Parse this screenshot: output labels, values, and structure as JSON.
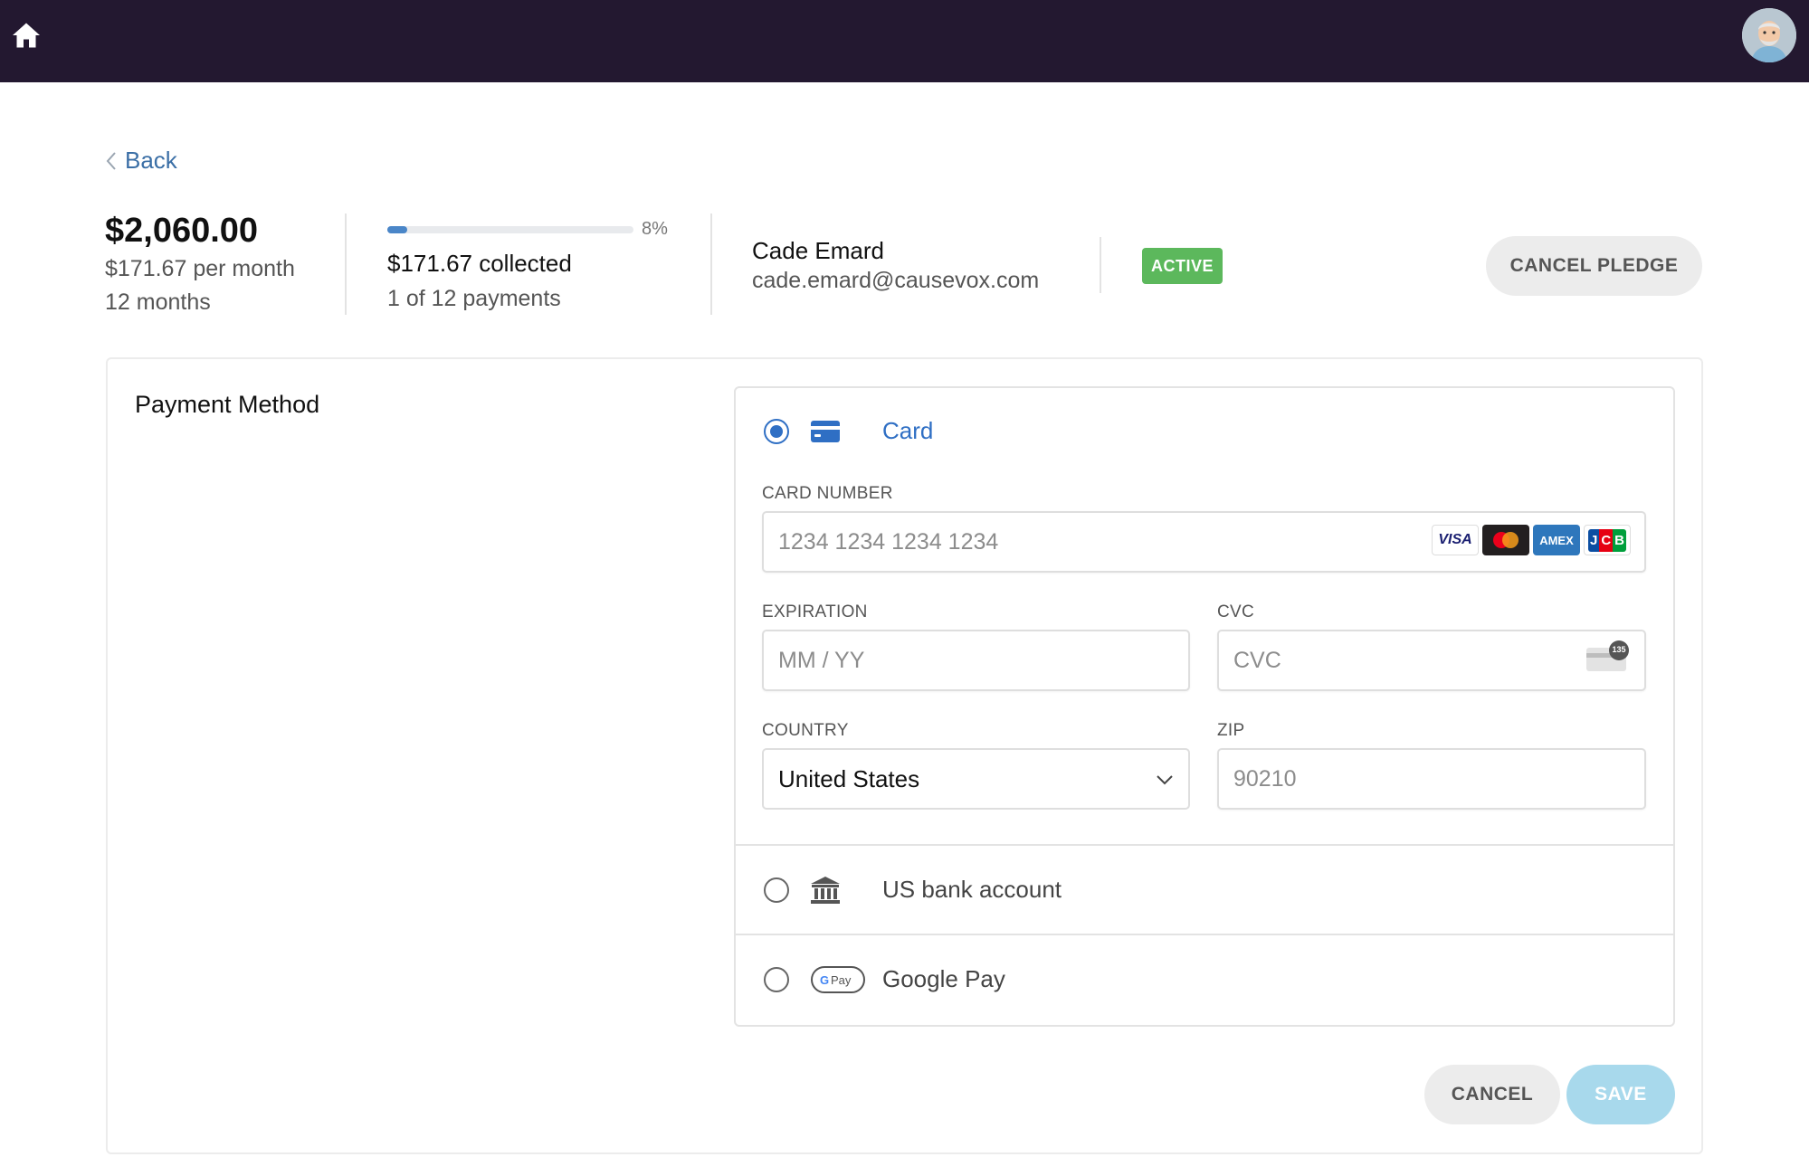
{
  "topbar": {
    "home_icon": "home-icon",
    "avatar_icon": "user-avatar"
  },
  "back": {
    "label": "Back"
  },
  "summary": {
    "amount": "$2,060.00",
    "per_month": "$171.67 per month",
    "duration": "12 months"
  },
  "progress": {
    "fraction": 0.08,
    "percent_label": "8%",
    "collected": "$171.67 collected",
    "payments": "1 of 12 payments"
  },
  "donor": {
    "name": "Cade Emard",
    "email": "cade.emard@causevox.com",
    "status": "ACTIVE"
  },
  "actions": {
    "cancel_pledge": "CANCEL PLEDGE"
  },
  "payment_method": {
    "title": "Payment Method",
    "options": [
      {
        "label": "Card",
        "icon": "credit-card-icon",
        "selected": true
      },
      {
        "label": "US bank account",
        "icon": "bank-icon",
        "selected": false
      },
      {
        "label": "Google Pay",
        "icon": "google-pay-icon",
        "selected": false
      }
    ],
    "card_number": {
      "label": "CARD NUMBER",
      "placeholder": "1234 1234 1234 1234"
    },
    "brands": [
      "VISA",
      "mastercard",
      "AMEX",
      "JCB"
    ],
    "expiration": {
      "label": "EXPIRATION",
      "placeholder": "MM / YY"
    },
    "cvc": {
      "label": "CVC",
      "placeholder": "CVC",
      "icon_badge": "135"
    },
    "country": {
      "label": "COUNTRY",
      "value": "United States"
    },
    "zip": {
      "label": "ZIP",
      "placeholder": "90210"
    }
  },
  "footer": {
    "cancel": "CANCEL",
    "save": "SAVE"
  },
  "colors": {
    "topbar": "#231830",
    "accent": "#2f6fc4",
    "status_active": "#5cb85c",
    "save_disabled": "#a8d9ec"
  }
}
